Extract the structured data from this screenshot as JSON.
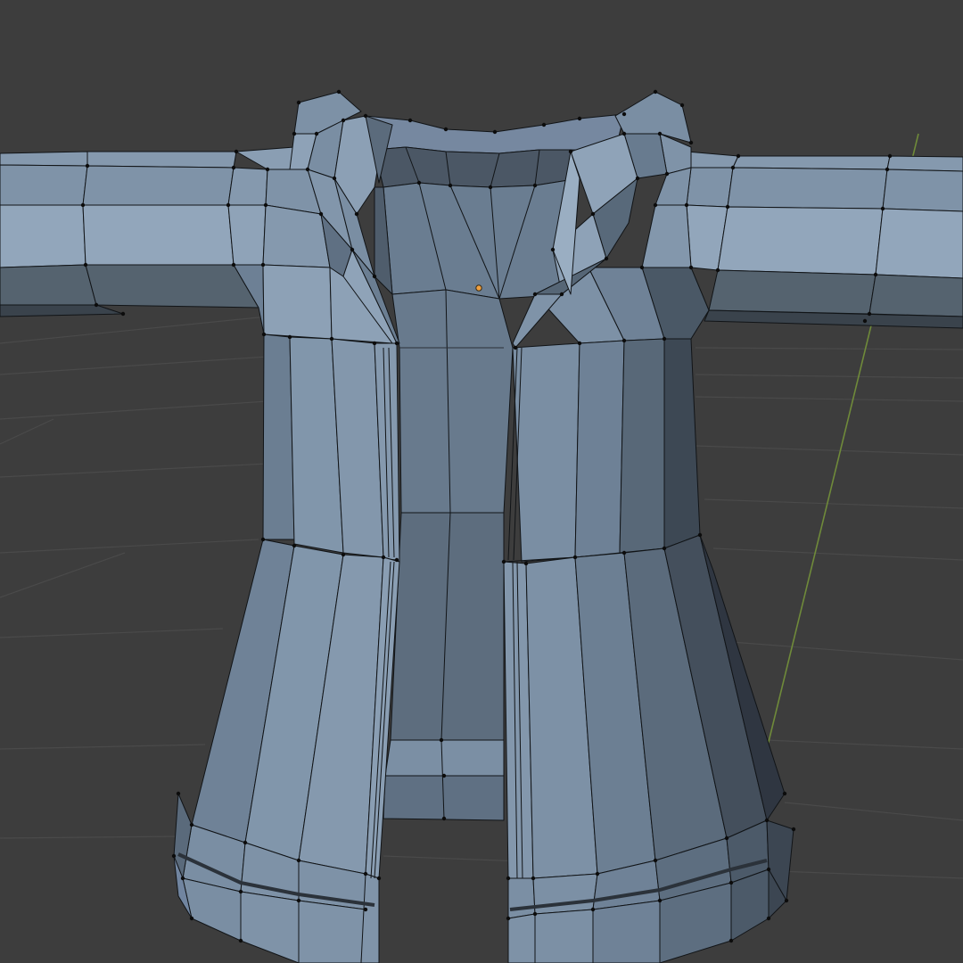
{
  "viewport": {
    "editor": "3d-viewport",
    "mode": "edit-mode",
    "object": "coat-mesh",
    "shading": "solid",
    "overlays": {
      "grid_floor": true,
      "y_axis_line": true,
      "vertices": true,
      "wireframe_edges": true
    }
  },
  "colors": {
    "background": "#3d3d3d",
    "grid_line": "#494949",
    "y_axis": "#6f8a3a",
    "mesh_light": "#8599ae",
    "mesh_mid": "#6c7f93",
    "mesh_dark": "#4c5a69",
    "mesh_shadow": "#2f3641",
    "edge": "#111417",
    "vertex": "#0c0c0c",
    "origin": "#f0a040"
  }
}
